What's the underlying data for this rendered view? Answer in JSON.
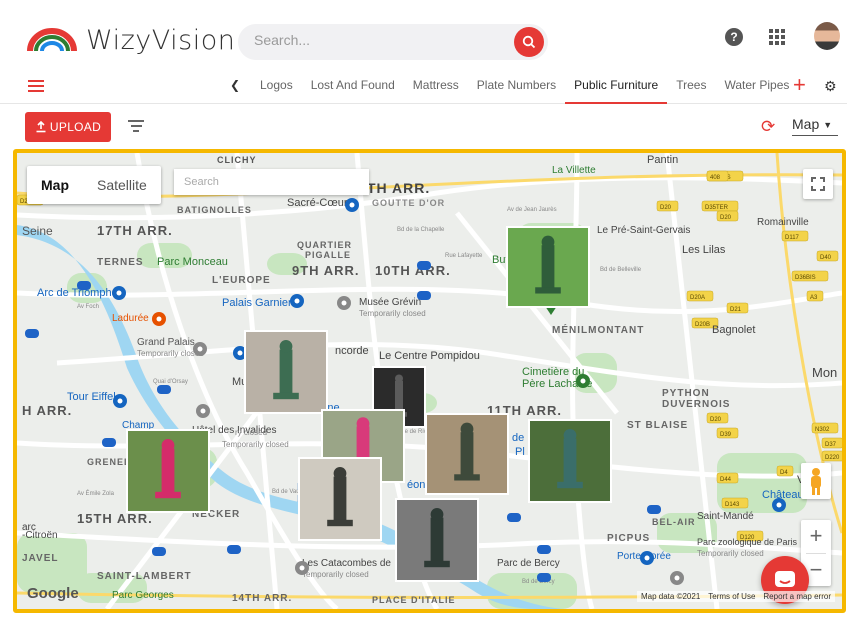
{
  "app": {
    "name": "WizyVision"
  },
  "header": {
    "search_placeholder": "Search...",
    "help_icon": "?"
  },
  "tabs": {
    "items": [
      "Logos",
      "Lost And Found",
      "Mattress",
      "Plate Numbers",
      "Public Furniture",
      "Trees",
      "Water Pipes"
    ],
    "active": "Public Furniture"
  },
  "toolbar": {
    "upload_label": "UPLOAD",
    "view_label": "Map"
  },
  "map": {
    "map_type": {
      "map": "Map",
      "satellite": "Satellite"
    },
    "search_placeholder": "Search",
    "google": "Google",
    "attribution": "Map data ©2021",
    "terms": "Terms of Use",
    "report": "Report a map error",
    "labels": [
      "CLICHY",
      "Pantin",
      "La Villette",
      "BATIGNOLLES",
      "Sacré-Cœur",
      "GOUTTE D'OR",
      "TH ARR.",
      "Seine",
      "17TH ARR.",
      "Le Pré-Saint-Gervais",
      "Romainville",
      "QUARTIER",
      "PIGALLE",
      "9TH ARR.",
      "10TH ARR.",
      "Les Lilas",
      "TERNES",
      "Parc Monceau",
      "L'EUROPE",
      "Arc de Triomphe",
      "Palais Garnier",
      "Musée Grévin",
      "Temporarily closed",
      "Ladurée",
      "Grand Palais",
      "Temporarily closed",
      "Le Centre Pompidou",
      "MÉNILMONTANT",
      "Bagnolet",
      "Cimetière du",
      "Père Lachaise",
      "Tour Eiffel",
      "H ARR.",
      "Place Dauphine",
      "PYTHON",
      "DUVERNOIS",
      "Mon",
      "Champ",
      "Hôtel des Invalides",
      "11TH ARR.",
      "ST BLAISE",
      "GRENELLE",
      "Le",
      "Lu",
      "15TH ARR.",
      "NECKER",
      "BEL-AIR",
      "Saint-Mandé",
      "Château",
      "Parc zoologique de Paris",
      "Temporarily closed",
      "Vinc",
      "-Citroën",
      "PICPUS",
      "Porte Dorée",
      "JAVEL",
      "Les Catacombes de",
      "Temporarily closed",
      "Parc de Bercy",
      "SAINT-LAMBERT",
      "Parc Georges",
      "14TH ARR.",
      "PLACE D'ITALIE",
      "12",
      "Butt",
      "Mus",
      "ncorde",
      "de la",
      "Pl",
      "éon",
      "arc",
      "Temporarily closed",
      "ry closed",
      "Bd de la Chapelle",
      "Rue Lafayette",
      "Bd de Belleville",
      "Av Foch",
      "Quai d'Orsay",
      "Av Émile Zola",
      "Rue de Rivoli",
      "Bd de Vaugirard",
      "Bd de Bercy",
      "Av de Jean Jaurès"
    ],
    "roads": [
      "D35BIS",
      "D20",
      "D35TER",
      "D20",
      "D117",
      "D40",
      "D36BIS",
      "D20A",
      "D21",
      "A3",
      "D20B",
      "D20",
      "D39",
      "N302",
      "D37",
      "D4",
      "D220",
      "D44",
      "D143",
      "D120",
      "D237",
      "408"
    ]
  },
  "colors": {
    "accent": "#e53935",
    "map_border": "#f5b800",
    "park": "#c8e6c0",
    "water": "#9fd6f2",
    "road": "#ffffff",
    "highway": "#fbd96b"
  },
  "icons": [
    "wizyvision-logo",
    "search-icon",
    "help-icon",
    "apps-icon",
    "avatar",
    "menu-icon",
    "chevron-left-icon",
    "add-icon",
    "gear-icon",
    "upload-icon",
    "filter-icon",
    "refresh-icon",
    "fullscreen-icon",
    "pegman-icon",
    "zoom-in-icon",
    "zoom-out-icon",
    "chat-icon"
  ]
}
